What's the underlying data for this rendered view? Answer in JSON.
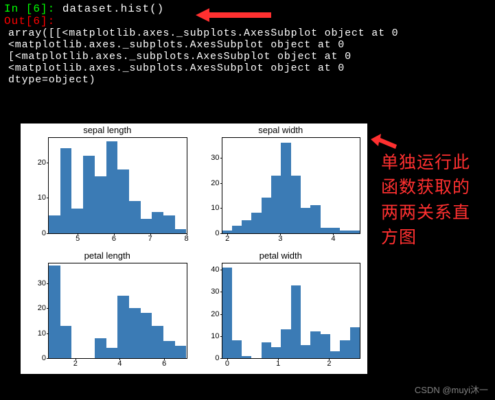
{
  "code": {
    "in_label": "In [",
    "in_num": "6",
    "in_close": "]:",
    "command": " dataset.hist()",
    "out_label": "Out[",
    "out_num": "6",
    "out_close": "]:",
    "lines": [
      "array([[<matplotlib.axes._subplots.AxesSubplot object at 0",
      "        <matplotlib.axes._subplots.AxesSubplot object at 0",
      "       [<matplotlib.axes._subplots.AxesSubplot object at 0",
      "        <matplotlib.axes._subplots.AxesSubplot object at 0",
      "      dtype=object)"
    ]
  },
  "annotation": "单独运行此\n函数获取的\n两两关系直\n方图",
  "watermark": "CSDN @muyi沐一",
  "chart_data": [
    {
      "type": "bar",
      "title": "sepal length",
      "xticks": [
        5,
        6,
        7,
        8
      ],
      "xlim": [
        4.2,
        8.0
      ],
      "yticks": [
        0,
        10,
        20
      ],
      "ylim": [
        0,
        27
      ],
      "counts": [
        5,
        24,
        7,
        22,
        16,
        26,
        18,
        9,
        4,
        6,
        5,
        1
      ]
    },
    {
      "type": "bar",
      "title": "sepal width",
      "xticks": [
        2,
        3,
        4
      ],
      "xlim": [
        1.9,
        4.5
      ],
      "yticks": [
        0,
        10,
        20,
        30
      ],
      "ylim": [
        0,
        38
      ],
      "counts": [
        1,
        3,
        5,
        8,
        14,
        23,
        36,
        23,
        10,
        11,
        2,
        2,
        1,
        1
      ]
    },
    {
      "type": "bar",
      "title": "petal length",
      "xticks": [
        2,
        4,
        6
      ],
      "xlim": [
        0.8,
        7.0
      ],
      "yticks": [
        0,
        10,
        20,
        30
      ],
      "ylim": [
        0,
        38
      ],
      "counts": [
        37,
        13,
        0,
        0,
        8,
        4,
        25,
        20,
        18,
        13,
        7,
        5
      ]
    },
    {
      "type": "bar",
      "title": "petal width",
      "xticks": [
        0,
        1,
        2
      ],
      "xlim": [
        -0.1,
        2.6
      ],
      "yticks": [
        0,
        10,
        20,
        30,
        40
      ],
      "ylim": [
        0,
        43
      ],
      "counts": [
        41,
        8,
        1,
        0,
        7,
        5,
        13,
        33,
        6,
        12,
        11,
        3,
        8,
        14
      ]
    }
  ]
}
